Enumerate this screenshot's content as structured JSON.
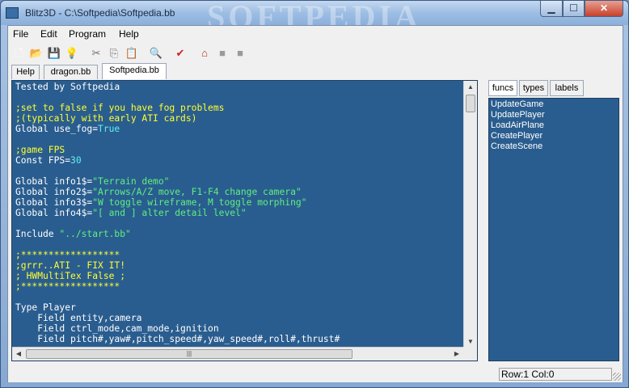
{
  "window": {
    "title": "Blitz3D - C:\\Softpedia\\Softpedia.bb",
    "watermark": "SOFTPEDIA",
    "min_glyph": "▁",
    "max_glyph": "☐",
    "close_glyph": "✕"
  },
  "menu": [
    "File",
    "Edit",
    "Program",
    "Help"
  ],
  "toolbar": [
    {
      "name": "new-file-icon",
      "glyph": "🗋",
      "color": "#ffffff"
    },
    {
      "name": "open-folder-icon",
      "glyph": "📂",
      "color": "#e8c040"
    },
    {
      "name": "save-icon",
      "glyph": "💾",
      "color": "#2b5fa8"
    },
    {
      "name": "close-file-icon",
      "glyph": "💡",
      "color": "#e0c050"
    },
    {
      "name": "cut-icon",
      "glyph": "✂",
      "color": "#707070"
    },
    {
      "name": "copy-icon",
      "glyph": "⎘",
      "color": "#707070"
    },
    {
      "name": "paste-icon",
      "glyph": "📋",
      "color": "#a07a40"
    },
    {
      "name": "find-icon",
      "glyph": "🔍",
      "color": "#2a6ab0"
    },
    {
      "name": "run-icon",
      "glyph": "✔",
      "color": "#cc2020"
    },
    {
      "name": "home-icon",
      "glyph": "⌂",
      "color": "#b03020"
    },
    {
      "name": "back-icon",
      "glyph": "■",
      "color": "#9a9a9a"
    },
    {
      "name": "forward-icon",
      "glyph": "■",
      "color": "#9a9a9a"
    }
  ],
  "tabs": [
    {
      "label": "Help",
      "active": false
    },
    {
      "label": "dragon.bb",
      "active": false
    },
    {
      "label": "Softpedia.bb",
      "active": true
    }
  ],
  "code_lines": [
    [
      {
        "t": "Tested by Softpedia",
        "c": "c-white"
      }
    ],
    [
      {
        "t": " ",
        "c": "c-white"
      }
    ],
    [
      {
        "t": ";set to false if you have fog problems",
        "c": "c-yellow"
      }
    ],
    [
      {
        "t": ";(typically with early ATI cards)",
        "c": "c-yellow"
      }
    ],
    [
      {
        "t": "Global use_fog=",
        "c": "c-white"
      },
      {
        "t": "True",
        "c": "c-kw"
      }
    ],
    [
      {
        "t": " ",
        "c": "c-white"
      }
    ],
    [
      {
        "t": ";game FPS",
        "c": "c-yellow"
      }
    ],
    [
      {
        "t": "Const FPS=",
        "c": "c-white"
      },
      {
        "t": "30",
        "c": "c-cyan"
      }
    ],
    [
      {
        "t": " ",
        "c": "c-white"
      }
    ],
    [
      {
        "t": "Global info1$=",
        "c": "c-white"
      },
      {
        "t": "\"Terrain demo\"",
        "c": "c-green"
      }
    ],
    [
      {
        "t": "Global info2$=",
        "c": "c-white"
      },
      {
        "t": "\"Arrows/A/Z move, F1-F4 change camera\"",
        "c": "c-green"
      }
    ],
    [
      {
        "t": "Global info3$=",
        "c": "c-white"
      },
      {
        "t": "\"W toggle wireframe, M toggle morphing\"",
        "c": "c-green"
      }
    ],
    [
      {
        "t": "Global info4$=",
        "c": "c-white"
      },
      {
        "t": "\"[ and ] alter detail level\"",
        "c": "c-green"
      }
    ],
    [
      {
        "t": " ",
        "c": "c-white"
      }
    ],
    [
      {
        "t": "Include ",
        "c": "c-white"
      },
      {
        "t": "\"../start.bb\"",
        "c": "c-green"
      }
    ],
    [
      {
        "t": " ",
        "c": "c-white"
      }
    ],
    [
      {
        "t": ";******************",
        "c": "c-yellow"
      }
    ],
    [
      {
        "t": ";grrr..ATI - FIX IT!",
        "c": "c-yellow"
      }
    ],
    [
      {
        "t": "; HWMultiTex False ;",
        "c": "c-yellow"
      }
    ],
    [
      {
        "t": ";******************",
        "c": "c-yellow"
      }
    ],
    [
      {
        "t": " ",
        "c": "c-white"
      }
    ],
    [
      {
        "t": "Type Player",
        "c": "c-white"
      }
    ],
    [
      {
        "t": "    Field entity,camera",
        "c": "c-white"
      }
    ],
    [
      {
        "t": "    Field ctrl_mode,cam_mode,ignition",
        "c": "c-white"
      }
    ],
    [
      {
        "t": "    Field pitch#,yaw#,pitch_speed#,yaw_speed#,roll#,thrust#",
        "c": "c-white"
      }
    ]
  ],
  "side_tabs": [
    {
      "label": "funcs",
      "active": true
    },
    {
      "label": "types",
      "active": false
    },
    {
      "label": "labels",
      "active": false
    }
  ],
  "side_items": [
    "UpdateGame",
    "UpdatePlayer",
    "LoadAirPlane",
    "CreatePlayer",
    "CreateScene"
  ],
  "status": "Row:1 Col:0"
}
